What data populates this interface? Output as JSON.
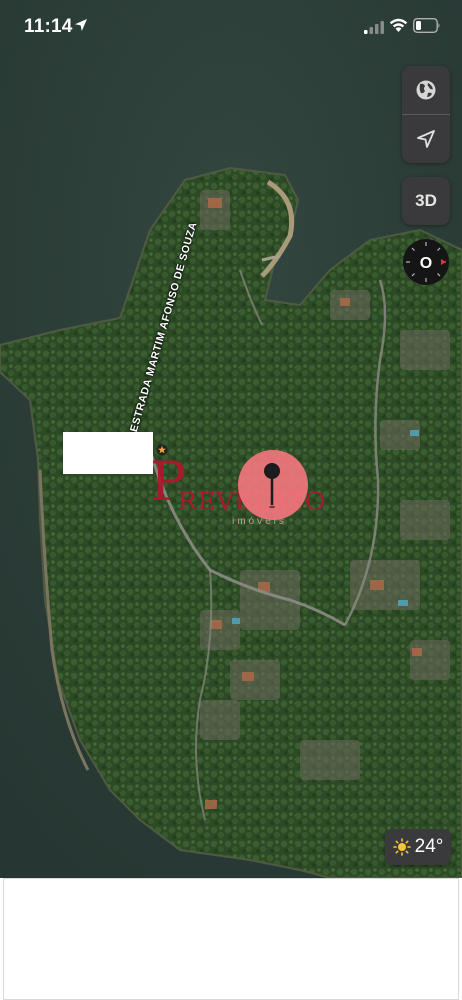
{
  "status_bar": {
    "time": "11:14",
    "location_icon": "location-arrow-icon",
    "signal_icon": "cellular-signal-icon",
    "wifi_icon": "wifi-icon",
    "battery_icon": "battery-low-icon"
  },
  "map": {
    "view": "satellite",
    "road_label": "ESTRADA MARTIM AFONSO DE SOUZA",
    "watermark": {
      "initial": "P",
      "brand": "REVELATO",
      "subtitle": "imóveis"
    }
  },
  "controls": {
    "map_mode_icon": "globe-icon",
    "locate_icon": "location-arrow-icon",
    "three_d_label": "3D",
    "compass_label": "O",
    "compass_icon": "compass-icon"
  },
  "weather": {
    "icon": "sun-icon",
    "temperature": "24°"
  },
  "colors": {
    "pin": "#fa7882",
    "watermark": "#b0172e",
    "control_bg": "#3a3a3c"
  }
}
